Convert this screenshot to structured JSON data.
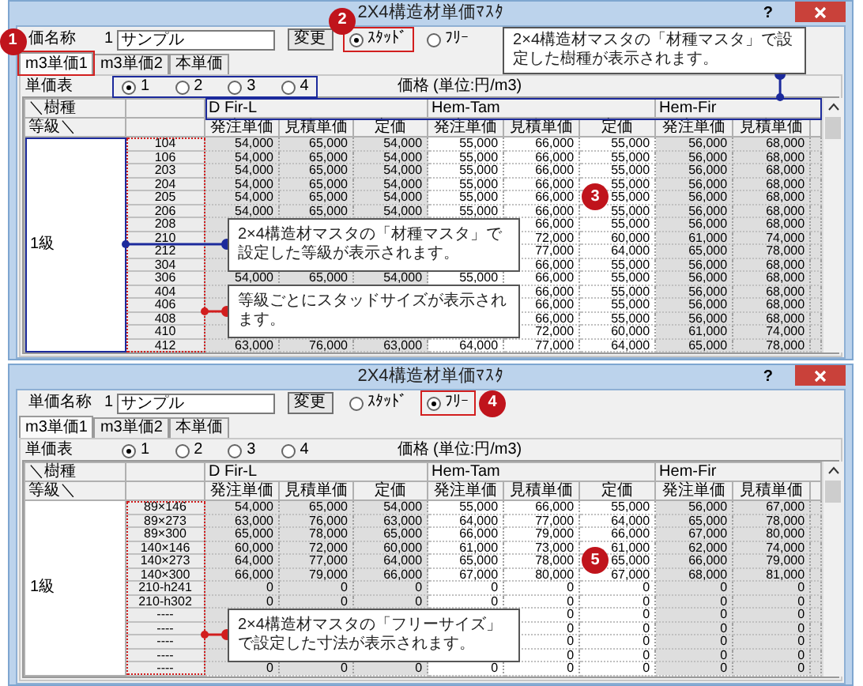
{
  "windows": [
    {
      "title": "2X4構造材単価ﾏｽﾀ",
      "help": "?",
      "name_label": "価名称",
      "name_number": "1",
      "name_value": "サンプル",
      "change_button": "変更",
      "size_modes": [
        {
          "label": "ｽﾀｯﾄﾞ",
          "selected": true
        },
        {
          "label": "ﾌﾘｰ",
          "selected": false
        }
      ],
      "tabs": [
        {
          "label": "m3単価1",
          "selected": true
        },
        {
          "label": "m3単価2",
          "selected": false
        },
        {
          "label": "本単価",
          "selected": false
        }
      ],
      "table_label": "単価表",
      "options_highlighted": true,
      "table_options": [
        {
          "label": "1",
          "selected": true
        },
        {
          "label": "2",
          "selected": false
        },
        {
          "label": "3",
          "selected": false
        },
        {
          "label": "4",
          "selected": false
        }
      ],
      "price_label": "価格 (単位:円/m3)",
      "table": {
        "corner_top": "＼樹種",
        "corner_bottom": "等級＼",
        "species": [
          {
            "name": "D Fir-L",
            "columns": [
              "発注単価",
              "見積単価",
              "定価"
            ]
          },
          {
            "name": "Hem-Tam",
            "columns": [
              "発注単価",
              "見積単価",
              "定価"
            ]
          },
          {
            "name": "Hem-Fir",
            "columns": [
              "発注単価",
              "見積単価"
            ]
          }
        ],
        "grade": "1級",
        "rows": [
          {
            "size": "104",
            "covered": false,
            "values": [
              "54,000",
              "65,000",
              "54,000",
              "55,000",
              "66,000",
              "55,000",
              "56,000",
              "68,000"
            ]
          },
          {
            "size": "106",
            "covered": false,
            "values": [
              "54,000",
              "65,000",
              "54,000",
              "55,000",
              "66,000",
              "55,000",
              "56,000",
              "68,000"
            ]
          },
          {
            "size": "203",
            "covered": false,
            "values": [
              "54,000",
              "65,000",
              "54,000",
              "55,000",
              "66,000",
              "55,000",
              "56,000",
              "68,000"
            ]
          },
          {
            "size": "204",
            "covered": false,
            "values": [
              "54,000",
              "65,000",
              "54,000",
              "55,000",
              "66,000",
              "55,000",
              "56,000",
              "68,000"
            ]
          },
          {
            "size": "205",
            "covered": false,
            "values": [
              "54,000",
              "65,000",
              "54,000",
              "55,000",
              "66,000",
              "55,000",
              "56,000",
              "68,000"
            ]
          },
          {
            "size": "206",
            "covered": false,
            "values": [
              "54,000",
              "65,000",
              "54,000",
              "55,000",
              "66,000",
              "55,000",
              "56,000",
              "68,000"
            ]
          },
          {
            "size": "208",
            "covered": true,
            "values": [
              "66,000",
              "55,000",
              "56,000",
              "68,000"
            ]
          },
          {
            "size": "210",
            "covered": true,
            "values": [
              "72,000",
              "60,000",
              "61,000",
              "74,000"
            ]
          },
          {
            "size": "212",
            "covered": true,
            "values": [
              "77,000",
              "64,000",
              "65,000",
              "78,000"
            ]
          },
          {
            "size": "304",
            "covered": true,
            "values": [
              "66,000",
              "55,000",
              "56,000",
              "68,000"
            ]
          },
          {
            "size": "306",
            "covered": false,
            "values": [
              "54,000",
              "65,000",
              "54,000",
              "55,000",
              "66,000",
              "55,000",
              "56,000",
              "68,000"
            ]
          },
          {
            "size": "404",
            "covered": true,
            "values": [
              "66,000",
              "55,000",
              "56,000",
              "68,000"
            ]
          },
          {
            "size": "406",
            "covered": true,
            "values": [
              "66,000",
              "55,000",
              "56,000",
              "68,000"
            ]
          },
          {
            "size": "408",
            "covered": true,
            "values": [
              "66,000",
              "55,000",
              "56,000",
              "68,000"
            ]
          },
          {
            "size": "410",
            "covered": true,
            "values": [
              "72,000",
              "60,000",
              "61,000",
              "74,000"
            ]
          },
          {
            "size": "412",
            "covered": false,
            "values": [
              "63,000",
              "76,000",
              "63,000",
              "64,000",
              "77,000",
              "64,000",
              "65,000",
              "78,000"
            ]
          }
        ]
      },
      "callouts": [
        {
          "kind": "species",
          "text": "2×4構造材マスタの「材種マスタ」で設定した樹種が表示されます。"
        },
        {
          "kind": "grade",
          "text": "2×4構造材マスタの「材種マスタ」で設定した等級が表示されます。"
        },
        {
          "kind": "size",
          "text": "等級ごとにスタッドサイズが表示されます。"
        }
      ],
      "badges": [
        {
          "number": "1",
          "kind": "tab"
        },
        {
          "number": "2",
          "kind": "mode"
        },
        {
          "number": "3",
          "kind": "cells"
        }
      ]
    },
    {
      "title": "2X4構造材単価ﾏｽﾀ",
      "help": "?",
      "name_label": "単価名称",
      "name_number": "1",
      "name_value": "サンプル",
      "change_button": "変更",
      "size_modes": [
        {
          "label": "ｽﾀｯﾄﾞ",
          "selected": false
        },
        {
          "label": "ﾌﾘｰ",
          "selected": true
        }
      ],
      "tabs": [
        {
          "label": "m3単価1",
          "selected": true
        },
        {
          "label": "m3単価2",
          "selected": false
        },
        {
          "label": "本単価",
          "selected": false
        }
      ],
      "table_label": "単価表",
      "options_highlighted": false,
      "table_options": [
        {
          "label": "1",
          "selected": true
        },
        {
          "label": "2",
          "selected": false
        },
        {
          "label": "3",
          "selected": false
        },
        {
          "label": "4",
          "selected": false
        }
      ],
      "price_label": "価格 (単位:円/m3)",
      "table": {
        "corner_top": "＼樹種",
        "corner_bottom": "等級＼",
        "species": [
          {
            "name": "D Fir-L",
            "columns": [
              "発注単価",
              "見積単価",
              "定価"
            ]
          },
          {
            "name": "Hem-Tam",
            "columns": [
              "発注単価",
              "見積単価",
              "定価"
            ]
          },
          {
            "name": "Hem-Fir",
            "columns": [
              "発注単価",
              "見積単価"
            ]
          }
        ],
        "grade": "1級",
        "rows": [
          {
            "size": "89×146",
            "covered": false,
            "values": [
              "54,000",
              "65,000",
              "54,000",
              "55,000",
              "66,000",
              "55,000",
              "56,000",
              "67,000"
            ]
          },
          {
            "size": "89×273",
            "covered": false,
            "values": [
              "63,000",
              "76,000",
              "63,000",
              "64,000",
              "77,000",
              "64,000",
              "65,000",
              "78,000"
            ]
          },
          {
            "size": "89×300",
            "covered": false,
            "values": [
              "65,000",
              "78,000",
              "65,000",
              "66,000",
              "79,000",
              "66,000",
              "67,000",
              "80,000"
            ]
          },
          {
            "size": "140×146",
            "covered": false,
            "values": [
              "60,000",
              "72,000",
              "60,000",
              "61,000",
              "73,000",
              "61,000",
              "62,000",
              "74,000"
            ]
          },
          {
            "size": "140×273",
            "covered": false,
            "values": [
              "64,000",
              "77,000",
              "64,000",
              "65,000",
              "78,000",
              "65,000",
              "66,000",
              "79,000"
            ]
          },
          {
            "size": "140×300",
            "covered": false,
            "values": [
              "66,000",
              "79,000",
              "66,000",
              "67,000",
              "80,000",
              "67,000",
              "68,000",
              "81,000"
            ]
          },
          {
            "size": "210-h241",
            "covered": false,
            "values": [
              "0",
              "0",
              "0",
              "0",
              "0",
              "0",
              "0",
              "0"
            ]
          },
          {
            "size": "210-h302",
            "covered": false,
            "values": [
              "0",
              "0",
              "0",
              "0",
              "0",
              "0",
              "0",
              "0"
            ]
          },
          {
            "size": "----",
            "covered": true,
            "values": [
              "0",
              "0",
              "0",
              "0"
            ]
          },
          {
            "size": "----",
            "covered": true,
            "values": [
              "0",
              "0",
              "0",
              "0"
            ]
          },
          {
            "size": "----",
            "covered": true,
            "values": [
              "0",
              "0",
              "0",
              "0"
            ]
          },
          {
            "size": "----",
            "covered": true,
            "values": [
              "0",
              "0",
              "0",
              "0"
            ]
          },
          {
            "size": "----",
            "covered": false,
            "values": [
              "0",
              "0",
              "0",
              "0",
              "0",
              "0",
              "0",
              "0"
            ]
          }
        ]
      },
      "callouts": [
        {
          "kind": "size",
          "text": "2×4構造材マスタの「フリーサイズ」で設定した寸法が表示されます。"
        }
      ],
      "badges": [
        {
          "number": "4",
          "kind": "mode"
        },
        {
          "number": "5",
          "kind": "cells"
        }
      ]
    }
  ]
}
